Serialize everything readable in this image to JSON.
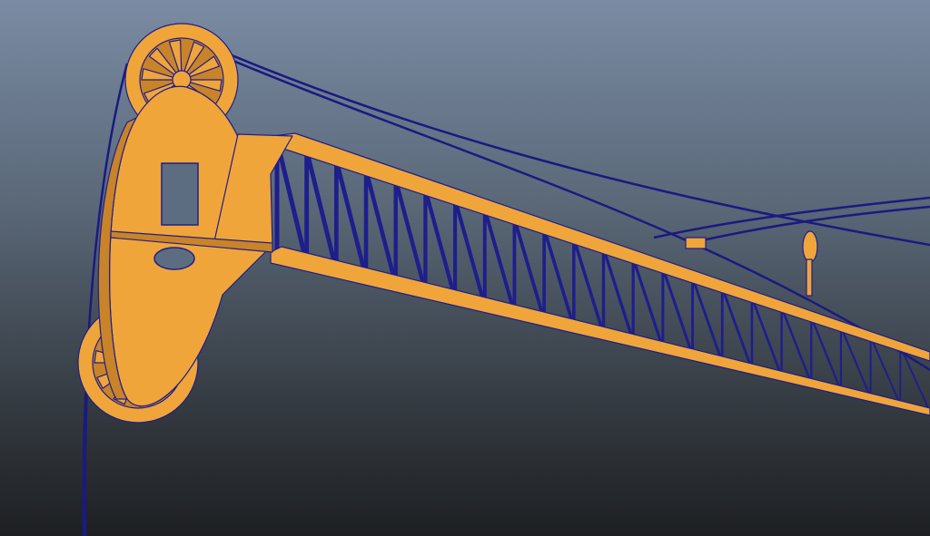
{
  "viewport": {
    "background_top": "#7a8ba3",
    "background_bottom": "#1d1f22"
  },
  "model": {
    "surface_color": "#f0a53a",
    "surface_shade": "#c98328",
    "wireframe_color": "#1e1e8c",
    "cable_color": "#1a1a80",
    "boom_truss_bays": 22
  }
}
